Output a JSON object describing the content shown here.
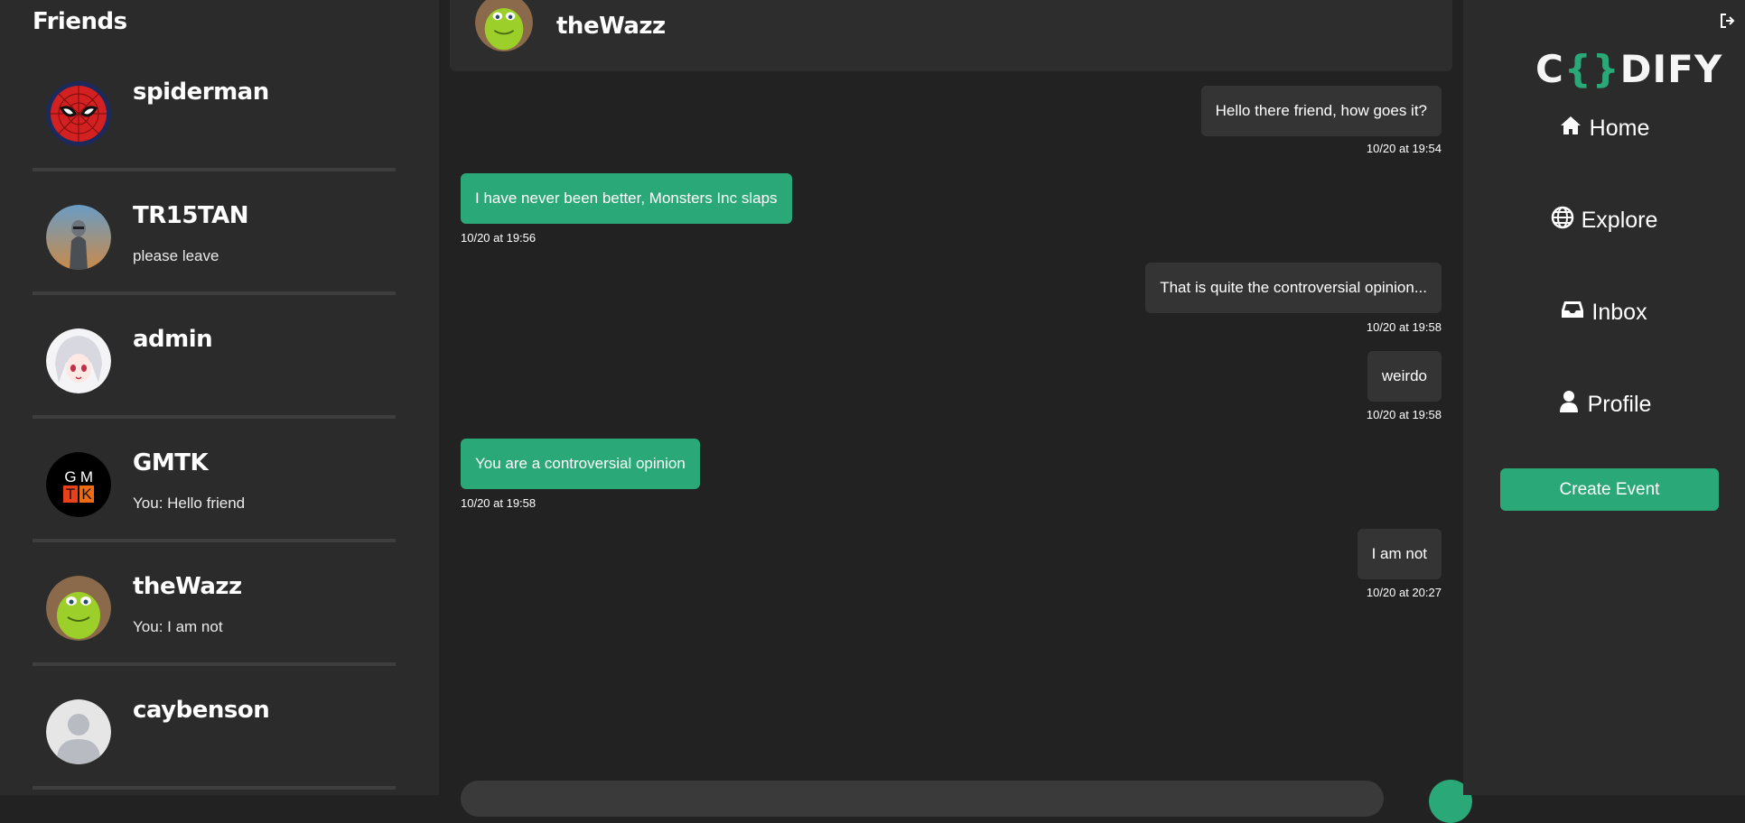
{
  "friends_panel": {
    "title": "Friends",
    "items": [
      {
        "name": "spiderman",
        "preview": ""
      },
      {
        "name": "TR15TAN",
        "preview": "please leave"
      },
      {
        "name": "admin",
        "preview": ""
      },
      {
        "name": "GMTK",
        "preview": "You: Hello friend",
        "avatar_letters": [
          "G",
          "M",
          "T",
          "K"
        ]
      },
      {
        "name": "theWazz",
        "preview": "You: I am not"
      },
      {
        "name": "caybenson",
        "preview": ""
      }
    ]
  },
  "chat": {
    "title": "theWazz",
    "messages": [
      {
        "direction": "out",
        "text": "Hello there friend, how goes it?",
        "time": "10/20 at 19:54"
      },
      {
        "direction": "in",
        "text": "I have never been better, Monsters Inc slaps",
        "time": "10/20 at 19:56"
      },
      {
        "direction": "out",
        "text": "That is quite the controversial opinion...",
        "time": "10/20 at 19:58"
      },
      {
        "direction": "out",
        "text": "weirdo",
        "time": "10/20 at 19:58"
      },
      {
        "direction": "in",
        "text": "You are a controversial opinion",
        "time": "10/20 at 19:58"
      },
      {
        "direction": "out",
        "text": "I am not",
        "time": "10/20 at 20:27"
      }
    ]
  },
  "nav": {
    "logo": {
      "left": "C",
      "brace_open": "{",
      "brace_close": "}",
      "right": "DIFY"
    },
    "items": [
      {
        "label": "Home",
        "icon": "home-icon"
      },
      {
        "label": "Explore",
        "icon": "globe-icon"
      },
      {
        "label": "Inbox",
        "icon": "inbox-icon"
      },
      {
        "label": "Profile",
        "icon": "user-icon"
      }
    ],
    "create_event": "Create Event",
    "logout_icon": "logout-icon"
  },
  "colors": {
    "accent": "#2aa877",
    "background": "#222222",
    "panel": "#2b2b2b",
    "bubble_out": "#343434"
  }
}
